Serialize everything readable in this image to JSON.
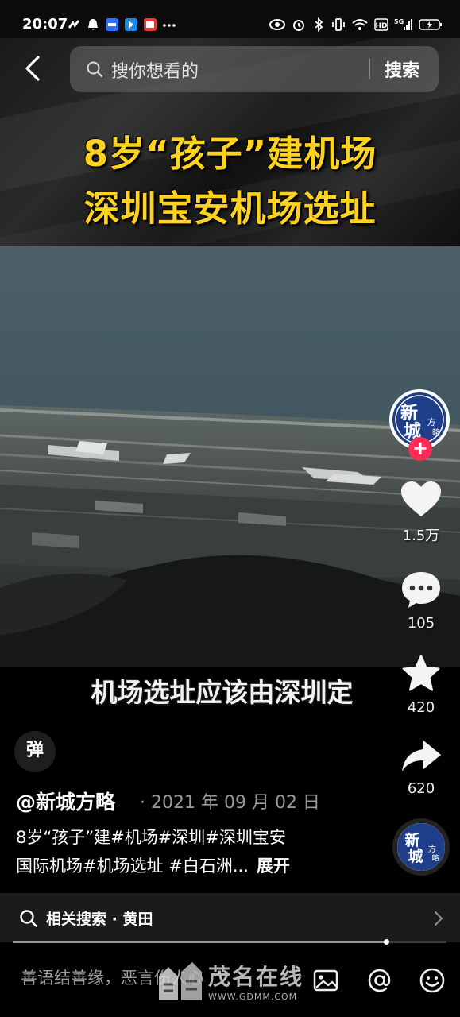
{
  "status_bar": {
    "time": "20:07",
    "left_icons": [
      "vpn-icon",
      "notification-bell-icon",
      "app-jdm-icon",
      "app-blue-icon",
      "app-red-icon",
      "more-dots-icon"
    ],
    "right_icons": [
      "eye-icon",
      "alarm-icon",
      "bluetooth-icon",
      "vibrate-icon",
      "wifi-icon",
      "hd-icon",
      "signal-5g-icon",
      "battery-icon"
    ]
  },
  "search": {
    "placeholder": "搜你想看的",
    "button_label": "搜索"
  },
  "video": {
    "title_line1": "8岁“孩子”建机场",
    "title_line2": "深圳宝安机场选址",
    "subtitle": "机场选址应该由深圳定"
  },
  "actions": {
    "avatar_text_main": "新城",
    "avatar_text_side": "方略",
    "follow": "+",
    "likes": "1.5万",
    "comments": "105",
    "favorites": "420",
    "shares": "620"
  },
  "danmu_label": "弹",
  "post": {
    "author": "@新城方略",
    "date": "· 2021 年 09 月 02 日",
    "desc_line1": "8岁“孩子”建#机场#深圳#深圳宝安",
    "desc_line2": "国际机场#机场选址 #白石洲...",
    "expand": "展开"
  },
  "related": {
    "text": "相关搜索 · 黄田"
  },
  "progress": {
    "fraction": 0.86
  },
  "comment_bar": {
    "placeholder": "善语结善缘，恶言伤人心"
  },
  "watermark": {
    "name": "茂名在线",
    "url": "WWW.GDMM.COM"
  },
  "colors": {
    "title_yellow": "#ffd21f",
    "follow_red": "#fe2c55",
    "avatar_blue": "#1f3f8a"
  }
}
